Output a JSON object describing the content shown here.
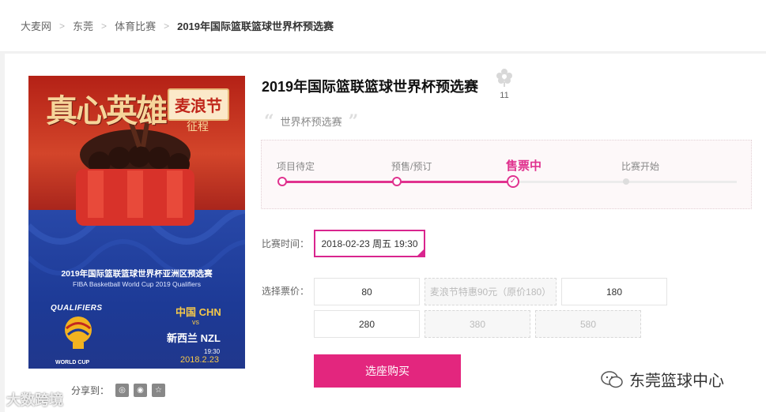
{
  "breadcrumb": [
    "大麦网",
    "东莞",
    "体育比赛",
    "2019年国际篮联篮球世界杯预选赛"
  ],
  "breadcrumb_sep": ">",
  "poster": {
    "calligraphy": "真心英雄",
    "badge": "麦浪节",
    "journey": "征程",
    "cn_title": "2019年国际篮联篮球世界杯亚洲区预选赛",
    "en_title": "FIBA Basketball World Cup 2019 Qualifiers",
    "qualifiers": "QUALIFIERS",
    "world_cup": "WORLD CUP",
    "team_home": "中国 CHN",
    "vs": "vs",
    "team_away": "新西兰 NZL",
    "time": "19:30",
    "date": "2018.2.23"
  },
  "share": {
    "label": "分享到：",
    "icons": [
      "weibo-icon",
      "wechat-icon",
      "star-icon"
    ]
  },
  "event": {
    "title": "2019年国际篮联篮球世界杯预选赛",
    "fav_count": "11",
    "subtitle": "世界杯预选赛",
    "quote_open": "“",
    "quote_close": "”"
  },
  "progress": {
    "steps": [
      "项目待定",
      "预售/预订",
      "售票中",
      "比赛开始"
    ],
    "active_index": 2
  },
  "session": {
    "label": "比赛时间：",
    "value": "2018-02-23 周五 19:30"
  },
  "prices": {
    "label": "选择票价：",
    "items": [
      {
        "text": "80",
        "available": true
      },
      {
        "text": "麦浪节特惠90元（原价180）",
        "available": false
      },
      {
        "text": "180",
        "available": true
      },
      {
        "text": "280",
        "available": true
      },
      {
        "text": "380",
        "available": false
      },
      {
        "text": "580",
        "available": false
      }
    ]
  },
  "buy_label": "选座购买",
  "watermarks": {
    "left": "大数跨境",
    "right": "东莞篮球中心"
  },
  "colors": {
    "accent": "#e3267e",
    "progress": "#e0338f"
  }
}
